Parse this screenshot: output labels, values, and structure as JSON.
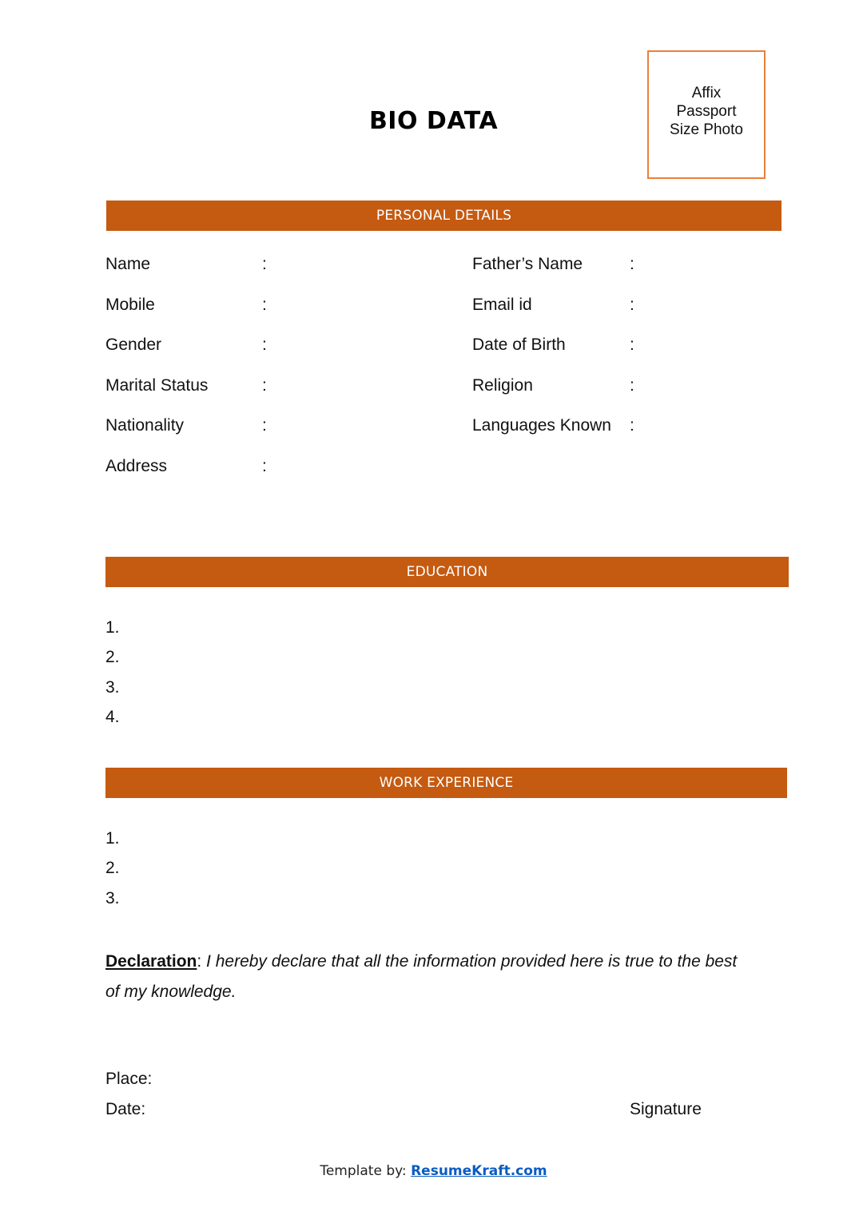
{
  "document": {
    "title": "BIO DATA",
    "photo_placeholder": "Affix\nPassport\nSize Photo",
    "accent_color": "#c55a11",
    "photo_border_color": "#e8803a"
  },
  "sections": {
    "personal_details": {
      "heading": "PERSONAL DETAILS",
      "left_fields": [
        {
          "label": "Name",
          "separator": ":",
          "value": ""
        },
        {
          "label": "Mobile",
          "separator": ":",
          "value": ""
        },
        {
          "label": "Gender",
          "separator": ":",
          "value": ""
        },
        {
          "label": "Marital Status",
          "separator": ":",
          "value": ""
        },
        {
          "label": "Nationality",
          "separator": ":",
          "value": ""
        },
        {
          "label": "Address",
          "separator": ":",
          "value": ""
        }
      ],
      "right_fields": [
        {
          "label": "Father’s Name",
          "separator": ":",
          "value": ""
        },
        {
          "label": "Email id",
          "separator": ":",
          "value": ""
        },
        {
          "label": "Date of Birth",
          "separator": ":",
          "value": ""
        },
        {
          "label": "Religion",
          "separator": ":",
          "value": ""
        },
        {
          "label": "Languages Known",
          "separator": ":",
          "value": ""
        }
      ]
    },
    "education": {
      "heading": "EDUCATION",
      "items": [
        "1.",
        "2.",
        "3.",
        "4."
      ]
    },
    "work_experience": {
      "heading": "WORK EXPERIENCE",
      "items": [
        "1.",
        "2.",
        "3."
      ]
    }
  },
  "declaration": {
    "label": "Declaration",
    "separator": ":",
    "text": " I hereby declare that all the information provided here is true to the best of my knowledge."
  },
  "signoff": {
    "place_label": "Place:",
    "date_label": "Date:",
    "signature_label": "Signature"
  },
  "footer": {
    "prefix": "Template by: ",
    "link_text": "ResumeKraft.com"
  }
}
